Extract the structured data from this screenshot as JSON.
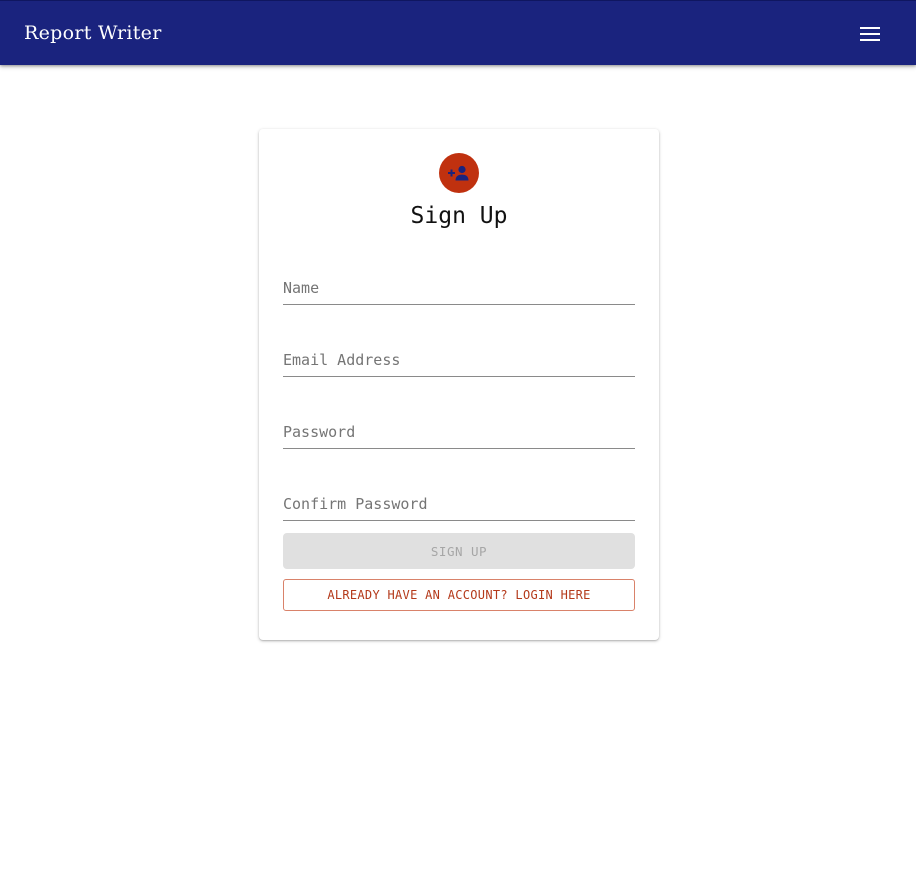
{
  "appbar": {
    "title": "Report Writer",
    "menu_icon": "menu-icon",
    "background": "#1a237e"
  },
  "signup_card": {
    "avatar_icon": "person-add-icon",
    "avatar_color": "#c0310f",
    "title": "Sign Up",
    "fields": {
      "name": {
        "placeholder": "Name",
        "value": ""
      },
      "email": {
        "placeholder": "Email Address",
        "value": ""
      },
      "password": {
        "placeholder": "Password",
        "value": ""
      },
      "confirm_password": {
        "placeholder": "Confirm Password",
        "value": ""
      }
    },
    "signup_label": "SIGN UP",
    "signup_disabled": true,
    "login_label": "ALREADY HAVE AN ACCOUNT? LOGIN HERE",
    "accent": "#b4391a"
  }
}
